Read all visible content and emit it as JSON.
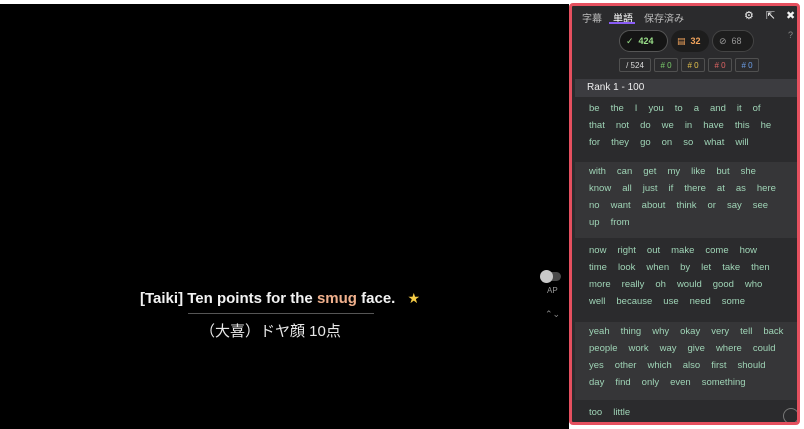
{
  "video": {
    "subtitle_speaker": "[Taiki]",
    "subtitle_pre": "Ten points for the",
    "subtitle_highlight": "smug",
    "subtitle_post": "face.",
    "subtitle_star": "★",
    "subtitle_ja": "（大喜）ドヤ顔 10点",
    "ap_label": "AP",
    "updown_glyph": "⌃⌄"
  },
  "panel": {
    "tabs": [
      "字幕",
      "単語",
      "保存済み"
    ],
    "active_tab": 1,
    "icons": [
      "gear-icon",
      "export-icon",
      "close-icon"
    ],
    "help": "?",
    "stats": {
      "known": "424",
      "learning": "32",
      "ignored": "68"
    },
    "counts": {
      "total": "/ 524",
      "green": "# 0",
      "yellow": "# 0",
      "red": "# 0",
      "blue": "# 0"
    },
    "rank_header": "Rank 1 - 100",
    "groups": [
      [
        [
          "be",
          "the",
          "I",
          "you",
          "to",
          "a",
          "and",
          "it",
          "of"
        ],
        [
          "that",
          "not",
          "do",
          "we",
          "in",
          "have",
          "this",
          "he"
        ],
        [
          "for",
          "they",
          "go",
          "on",
          "so",
          "what",
          "will"
        ]
      ],
      [
        [
          "with",
          "can",
          "get",
          "my",
          "like",
          "but",
          "she"
        ],
        [
          "know",
          "all",
          "just",
          "if",
          "there",
          "at",
          "as",
          "here"
        ],
        [
          "no",
          "want",
          "about",
          "think",
          "or",
          "say",
          "see"
        ],
        [
          "up",
          "from"
        ]
      ],
      [
        [
          "now",
          "right",
          "out",
          "make",
          "come",
          "how"
        ],
        [
          "time",
          "look",
          "when",
          "by",
          "let",
          "take",
          "then"
        ],
        [
          "more",
          "really",
          "oh",
          "would",
          "good",
          "who"
        ],
        [
          "well",
          "because",
          "use",
          "need",
          "some"
        ]
      ],
      [
        [
          "yeah",
          "thing",
          "why",
          "okay",
          "very",
          "tell",
          "back"
        ],
        [
          "people",
          "work",
          "way",
          "give",
          "where",
          "could"
        ],
        [
          "yes",
          "other",
          "which",
          "also",
          "first",
          "should"
        ],
        [
          "day",
          "find",
          "only",
          "even",
          "something"
        ]
      ],
      [
        [
          "too",
          "little"
        ]
      ]
    ],
    "colors": {
      "border": "#e5505f",
      "word": "#9fd4b6",
      "known": "#9be08a",
      "learning": "#f0a35c"
    }
  }
}
